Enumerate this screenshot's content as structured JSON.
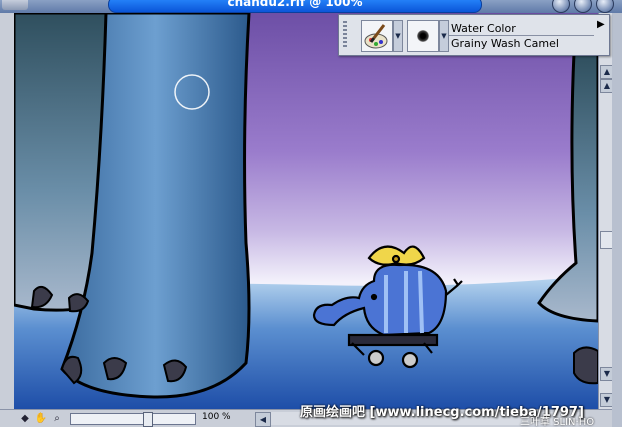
{
  "window": {
    "title": "chandu2.rif @ 100%"
  },
  "brush_bar": {
    "category_label": "Water Color",
    "variant_label": "Grainy Wash Camel",
    "brush_icon": "paintbrush-palette-icon",
    "variant_icon": "dab-dot-icon",
    "menu_arrow": "▶"
  },
  "status_bar": {
    "zoom_text": "100 %",
    "zoom_fraction": 0.62
  },
  "watermark": {
    "text": "原画绘画吧 [www.linecg.com/tieba/1797]",
    "text_small": "三叶草 SLIN·HO"
  },
  "colors": {
    "title_accent": "#1a6ef0",
    "canvas_purple": "#8a6ab8",
    "canvas_blue": "#3a6cc0"
  }
}
